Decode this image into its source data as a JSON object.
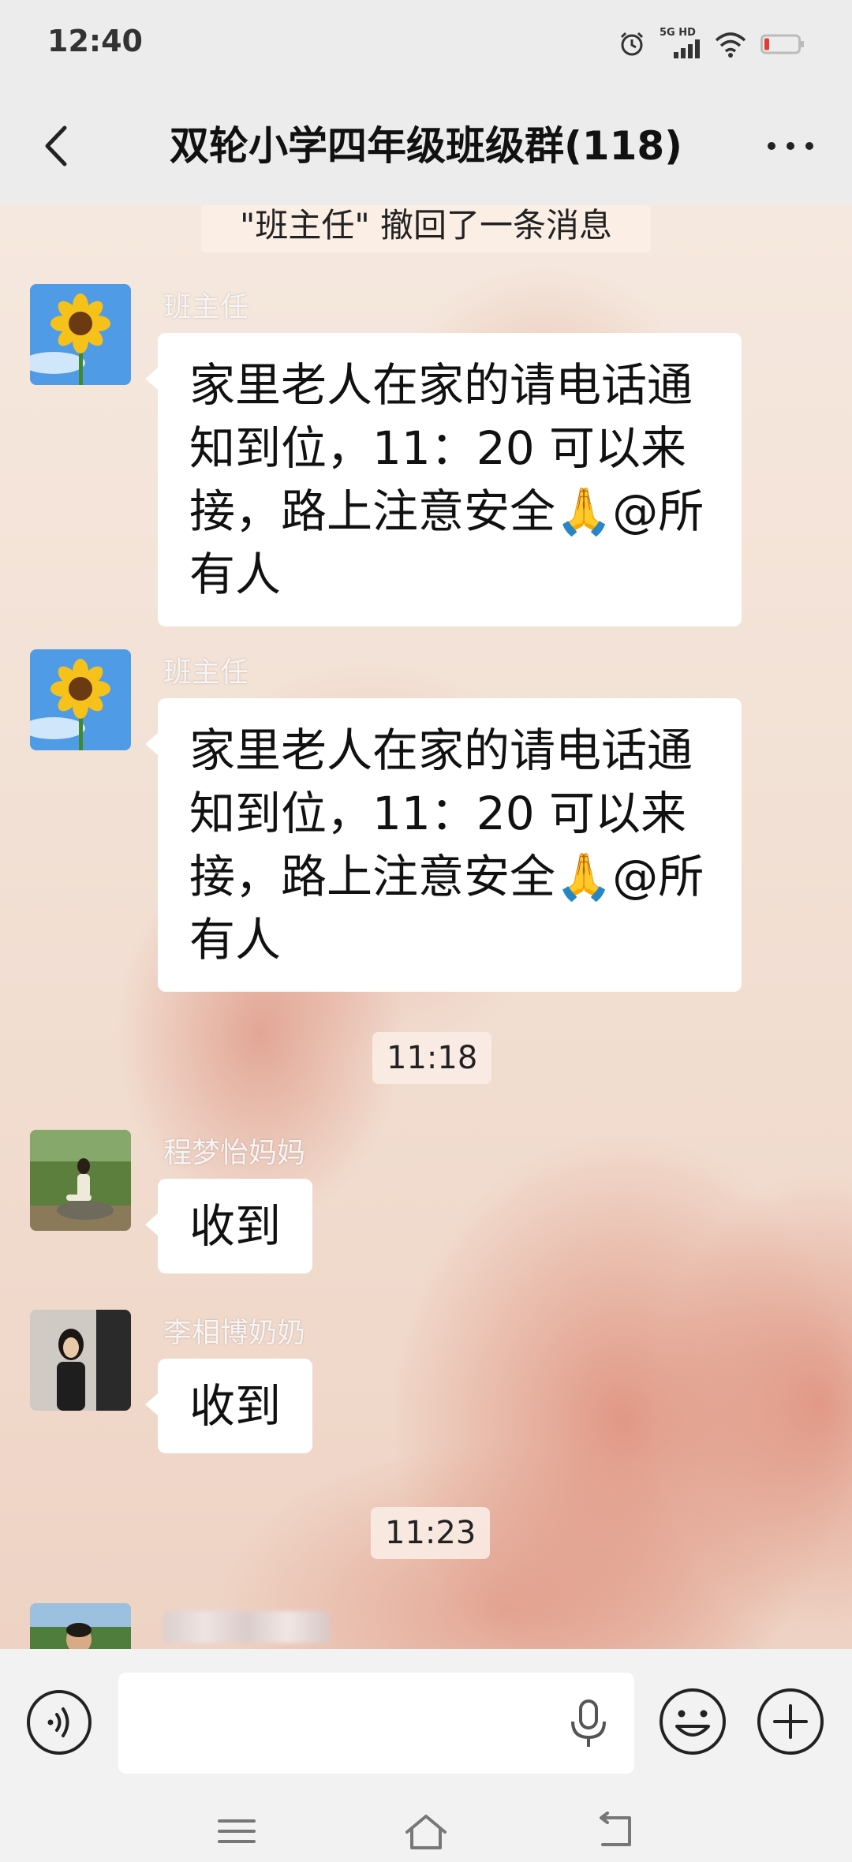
{
  "status_bar": {
    "time": "12:40",
    "network_label": "5G HD",
    "icons": [
      "alarm-icon",
      "signal-icon",
      "wifi-icon",
      "battery-icon"
    ]
  },
  "header": {
    "title": "双轮小学四年级班级群(118)"
  },
  "chat": {
    "system_notice": "\"班主任\" 撤回了一条消息",
    "messages": [
      {
        "sender": "班主任",
        "avatar": "sunflower-avatar",
        "text_lines": [
          "家里老人在家的请电话通",
          "知到位，11：20 可以来",
          "接，路上注意安全🙏@所",
          "有人"
        ]
      },
      {
        "sender": "班主任",
        "avatar": "sunflower-avatar",
        "text_lines": [
          "家里老人在家的请电话通",
          "知到位，11：20 可以来",
          "接，路上注意安全🙏@所",
          "有人"
        ]
      },
      {
        "sender": "程梦怡妈妈",
        "avatar": "photo-avatar",
        "text": "收到"
      },
      {
        "sender": "李相博奶奶",
        "avatar": "photo-avatar",
        "text": "收到"
      }
    ],
    "timestamps": [
      "11:18",
      "11:23"
    ]
  },
  "input_bar": {
    "message_value": "",
    "icons": [
      "voice-icon",
      "microphone-icon",
      "emoji-icon",
      "plus-icon"
    ]
  },
  "nav_bar": {
    "icons": [
      "menu-icon",
      "home-icon",
      "back-nav-icon"
    ]
  },
  "colors": {
    "bar_background": "#ececec",
    "bubble": "#ffffff",
    "chat_background": "#f3e3d8",
    "heart_accent": "#dc826e"
  }
}
